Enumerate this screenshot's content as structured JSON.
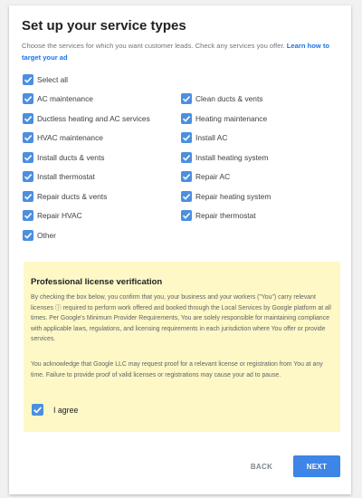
{
  "dialog": {
    "title": "Set up your service types",
    "description": "Choose the services for which you want customer leads. Check any services you offer. ",
    "learn_link": "Learn how to target your ad"
  },
  "services": {
    "select_all": "Select all",
    "left": [
      "AC maintenance",
      "Ductless heating and AC services",
      "HVAC maintenance",
      "Install ducts & vents",
      "Install thermostat",
      "Repair ducts & vents",
      "Repair HVAC",
      "Other"
    ],
    "right": [
      "Clean ducts & vents",
      "Heating maintenance",
      "Install AC",
      "Install heating system",
      "Repair AC",
      "Repair heating system",
      "Repair thermostat"
    ],
    "all_checked": true
  },
  "license": {
    "title": "Professional license verification",
    "paragraph1": "By checking the box below, you confirm that you, your business and your workers (\"You\") carry relevant licenses ⓘ required to perform work offered and booked through the Local Services by Google platform at all times. Per Google's Minimum Provider Requirements, You are solely responsible for maintaining compliance with applicable laws, regulations, and licensing requirements in each jurisdiction where You offer or provide services.",
    "paragraph2": "You acknowledge that Google LLC may request proof for a relevant license or registration from You at any time. Failure to provide proof of valid licenses or registrations may cause your ad to pause.",
    "agree_label": "I agree",
    "agree_checked": true
  },
  "buttons": {
    "back": "BACK",
    "next": "NEXT"
  },
  "colors": {
    "accent": "#4b8fe0",
    "next_button": "#3d85e6",
    "license_bg": "#fdf8c6"
  }
}
